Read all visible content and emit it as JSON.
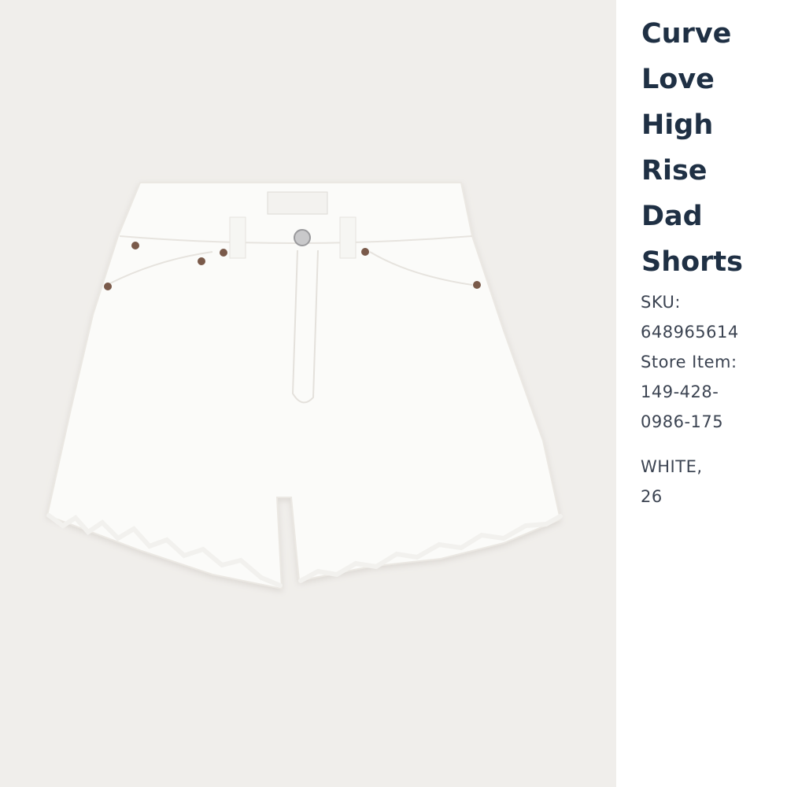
{
  "product": {
    "title_lines": [
      "Curve",
      "Love",
      "High",
      "Rise",
      "Dad",
      "Shorts"
    ],
    "sku_label": "SKU:",
    "sku_value": "648965614",
    "store_item_label": "Store Item:",
    "store_item_lines": [
      "149-428-",
      "0986-175"
    ],
    "variant_lines": [
      "WHITE,",
      "26"
    ]
  },
  "colors": {
    "photo_background": "#f0eeeb",
    "title_text": "#1f3044",
    "meta_text": "#3c4452",
    "garment": "#fbfbf9",
    "rivet": "#7a5a4a"
  },
  "image": {
    "subject": "white-denim-shorts-icon"
  }
}
